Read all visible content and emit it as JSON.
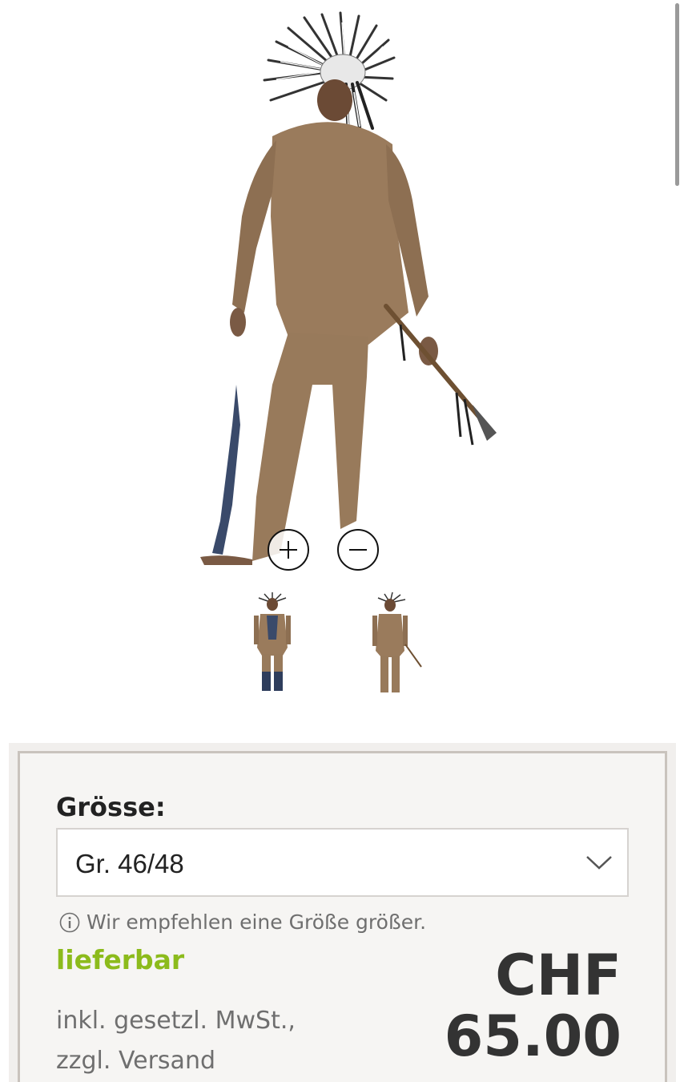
{
  "product": {
    "main_image_alt": "",
    "thumbnails": [
      "",
      ""
    ]
  },
  "zoom": {
    "zoom_in": "",
    "zoom_out": ""
  },
  "purchase": {
    "size_label": "Grösse:",
    "size_selected": "Gr. 46/48",
    "size_hint": "Wir empfehlen eine Größe größer.",
    "availability": "lieferbar",
    "tax_line1": "inkl. gesetzl. MwSt.,",
    "tax_line2": "zzgl. Versand",
    "currency": "CHF",
    "price": "65.00"
  },
  "colors": {
    "availability": "#8cbb1c",
    "panel_border": "#c9c3bd",
    "panel_bg": "#f6f5f3"
  },
  "icons": {
    "zoom_in": "plus-circle-icon",
    "zoom_out": "minus-circle-icon",
    "dropdown": "chevron-down-icon",
    "info": "info-circle-icon"
  }
}
